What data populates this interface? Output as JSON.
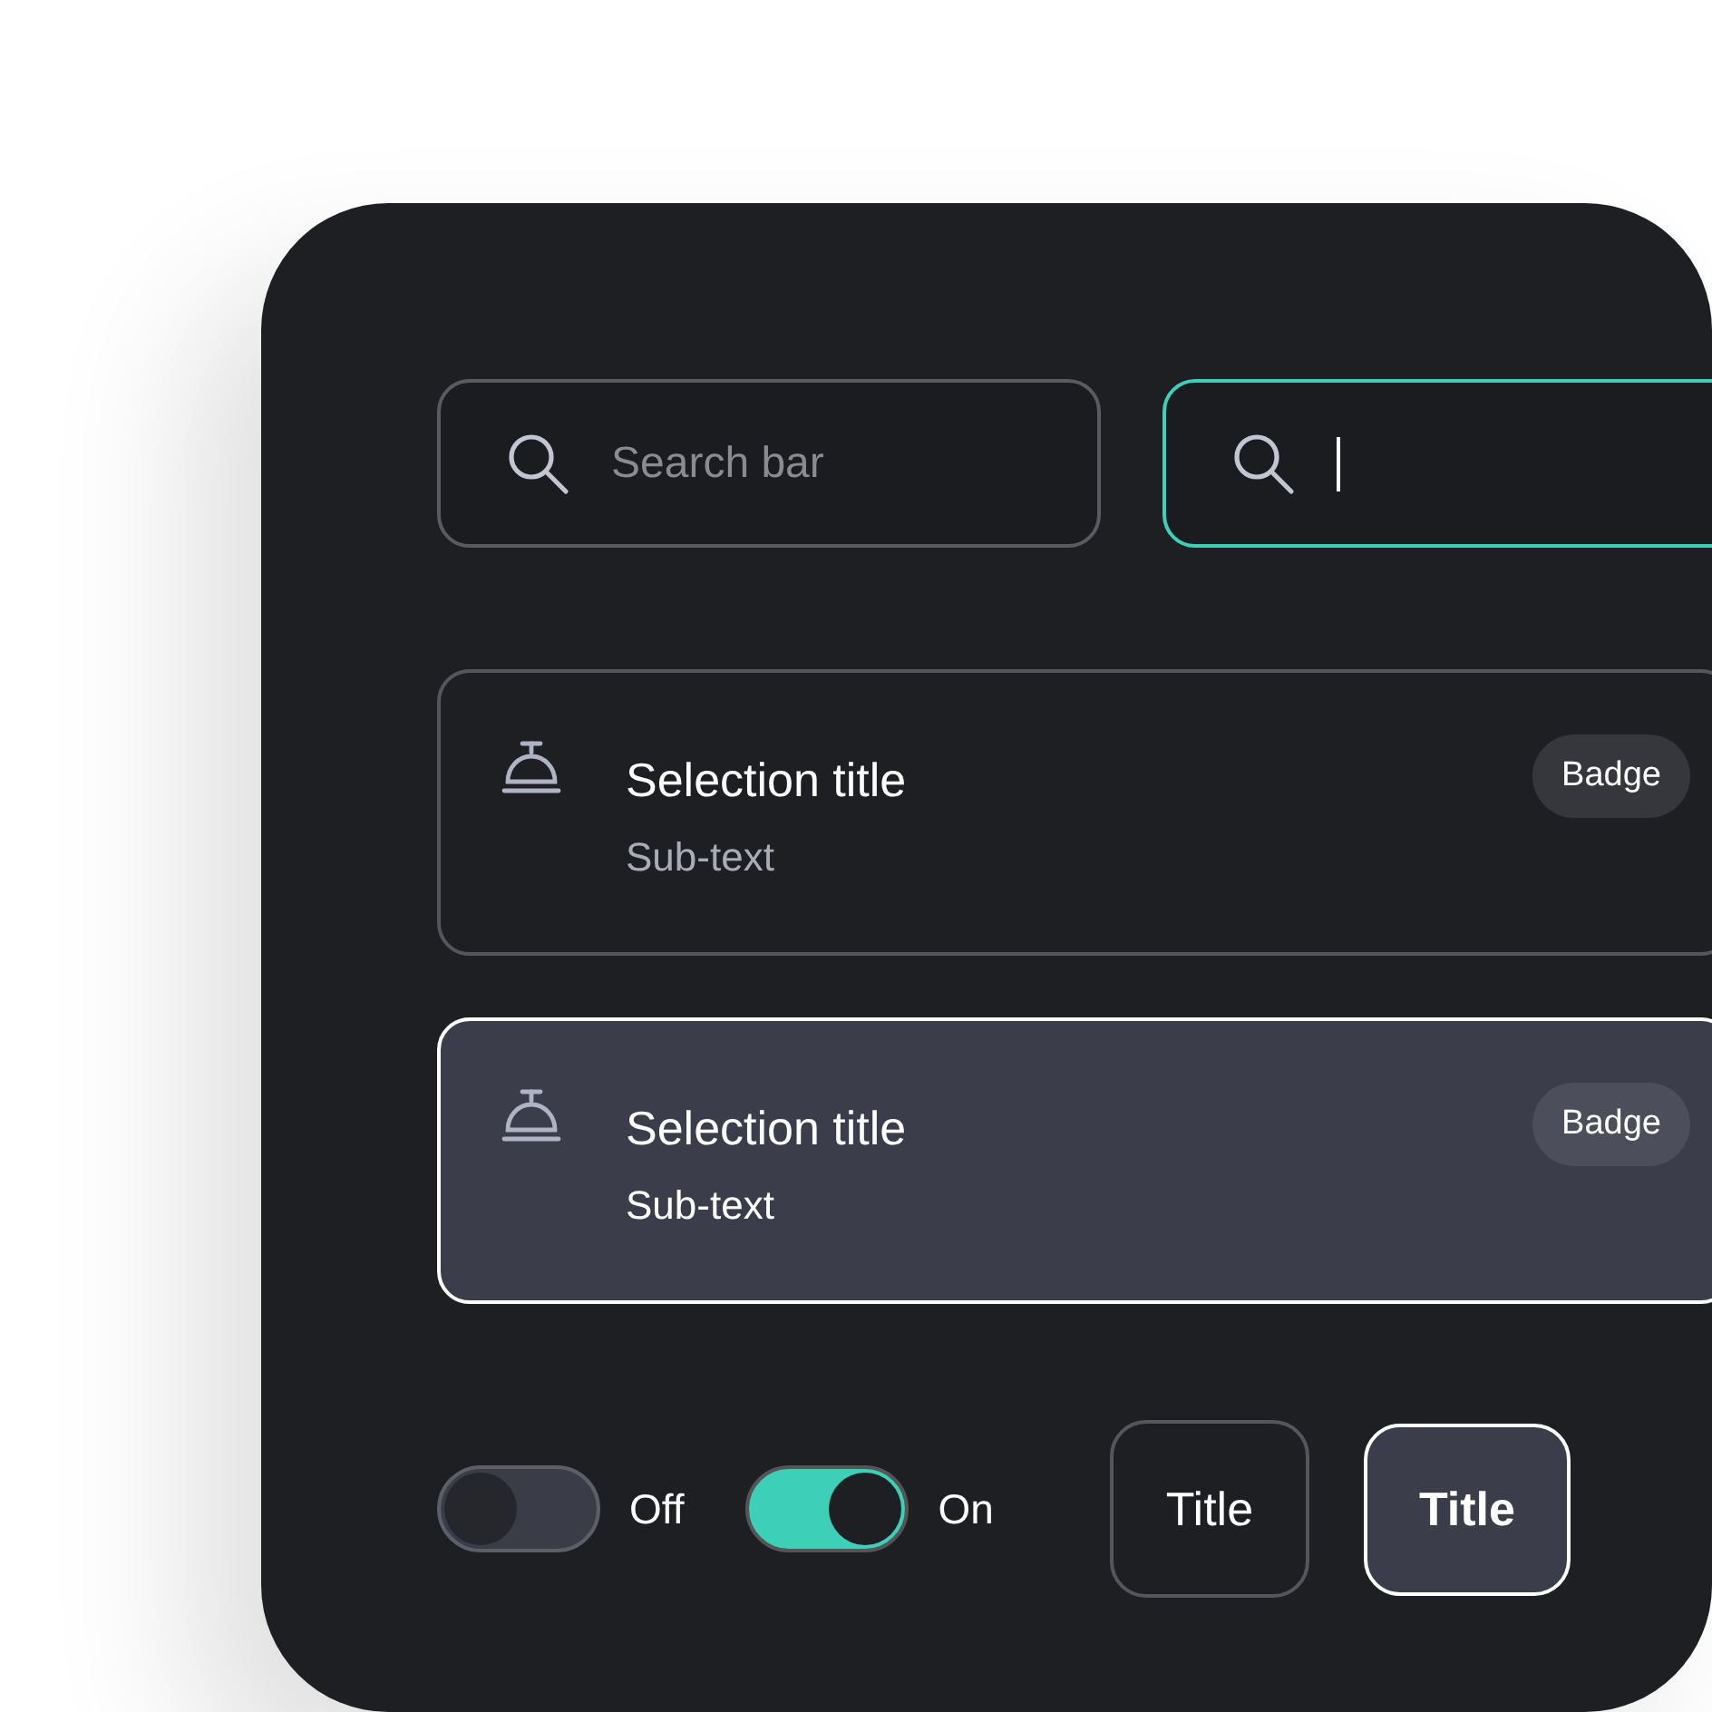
{
  "search_fields": [
    {
      "placeholder": "Search bar",
      "focused": false
    },
    {
      "focused": true
    }
  ],
  "selection_cards": [
    {
      "title": "Selection title",
      "subtext": "Sub-text",
      "badge": "Badge",
      "selected": false
    },
    {
      "title": "Selection title",
      "subtext": "Sub-text",
      "badge": "Badge",
      "selected": true
    }
  ],
  "toggles": [
    {
      "label": "Off",
      "on": false
    },
    {
      "label": "On",
      "on": true
    }
  ],
  "title_buttons": [
    {
      "label": "Title",
      "selected": false
    },
    {
      "label": "Title",
      "selected": true
    }
  ]
}
